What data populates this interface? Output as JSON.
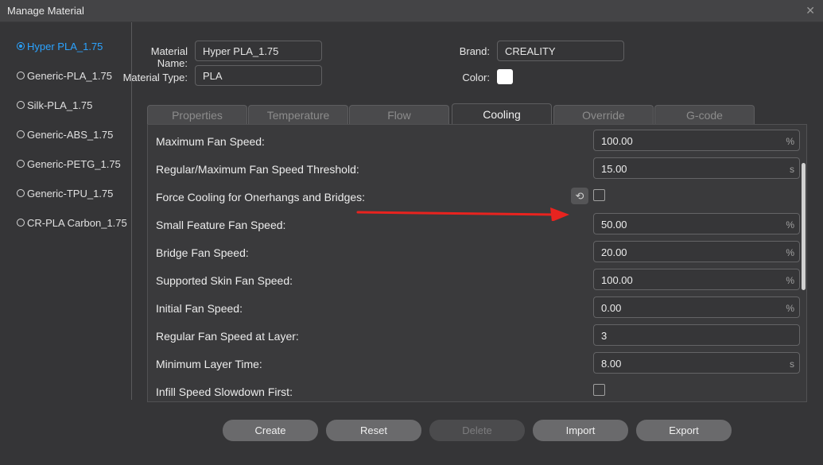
{
  "window": {
    "title": "Manage Material"
  },
  "materials": [
    {
      "label": "Hyper PLA_1.75",
      "selected": true
    },
    {
      "label": "Generic-PLA_1.75",
      "selected": false
    },
    {
      "label": "Silk-PLA_1.75",
      "selected": false
    },
    {
      "label": "Generic-ABS_1.75",
      "selected": false
    },
    {
      "label": "Generic-PETG_1.75",
      "selected": false
    },
    {
      "label": "Generic-TPU_1.75",
      "selected": false
    },
    {
      "label": "CR-PLA Carbon_1.75",
      "selected": false
    }
  ],
  "info": {
    "material_name_label": "Material Name:",
    "material_name_value": "Hyper PLA_1.75",
    "material_type_label": "Material Type:",
    "material_type_value": "PLA",
    "brand_label": "Brand:",
    "brand_value": "CREALITY",
    "color_label": "Color:",
    "color_value": "#ffffff"
  },
  "tabs": [
    {
      "label": "Properties",
      "active": false
    },
    {
      "label": "Temperature",
      "active": false
    },
    {
      "label": "Flow",
      "active": false
    },
    {
      "label": "Cooling",
      "active": true
    },
    {
      "label": "Override",
      "active": false
    },
    {
      "label": "G-code",
      "active": false
    }
  ],
  "cooling": [
    {
      "label": "Maximum Fan Speed:",
      "value": "100.00",
      "unit": "%"
    },
    {
      "label": "Regular/Maximum Fan Speed Threshold:",
      "value": "15.00",
      "unit": "s"
    },
    {
      "label": "Force Cooling for Onerhangs and Bridges:",
      "checked": false,
      "reset": true
    },
    {
      "label": "Small Feature Fan Speed:",
      "value": "50.00",
      "unit": "%"
    },
    {
      "label": "Bridge Fan Speed:",
      "value": "20.00",
      "unit": "%"
    },
    {
      "label": "Supported Skin Fan Speed:",
      "value": "100.00",
      "unit": "%"
    },
    {
      "label": "Initial Fan Speed:",
      "value": "0.00",
      "unit": "%"
    },
    {
      "label": "Regular Fan Speed at Layer:",
      "value": "3",
      "unit": ""
    },
    {
      "label": "Minimum Layer Time:",
      "value": "8.00",
      "unit": "s"
    },
    {
      "label": "Infill Speed Slowdown First:",
      "checked": false
    }
  ],
  "buttons": {
    "create": "Create",
    "reset": "Reset",
    "delete": "Delete",
    "import": "Import",
    "export": "Export"
  },
  "icons": {
    "close": "close-icon",
    "reset": "undo-icon"
  },
  "colors": {
    "accent": "#2ba3ff",
    "annotation_arrow": "#e8231f"
  }
}
